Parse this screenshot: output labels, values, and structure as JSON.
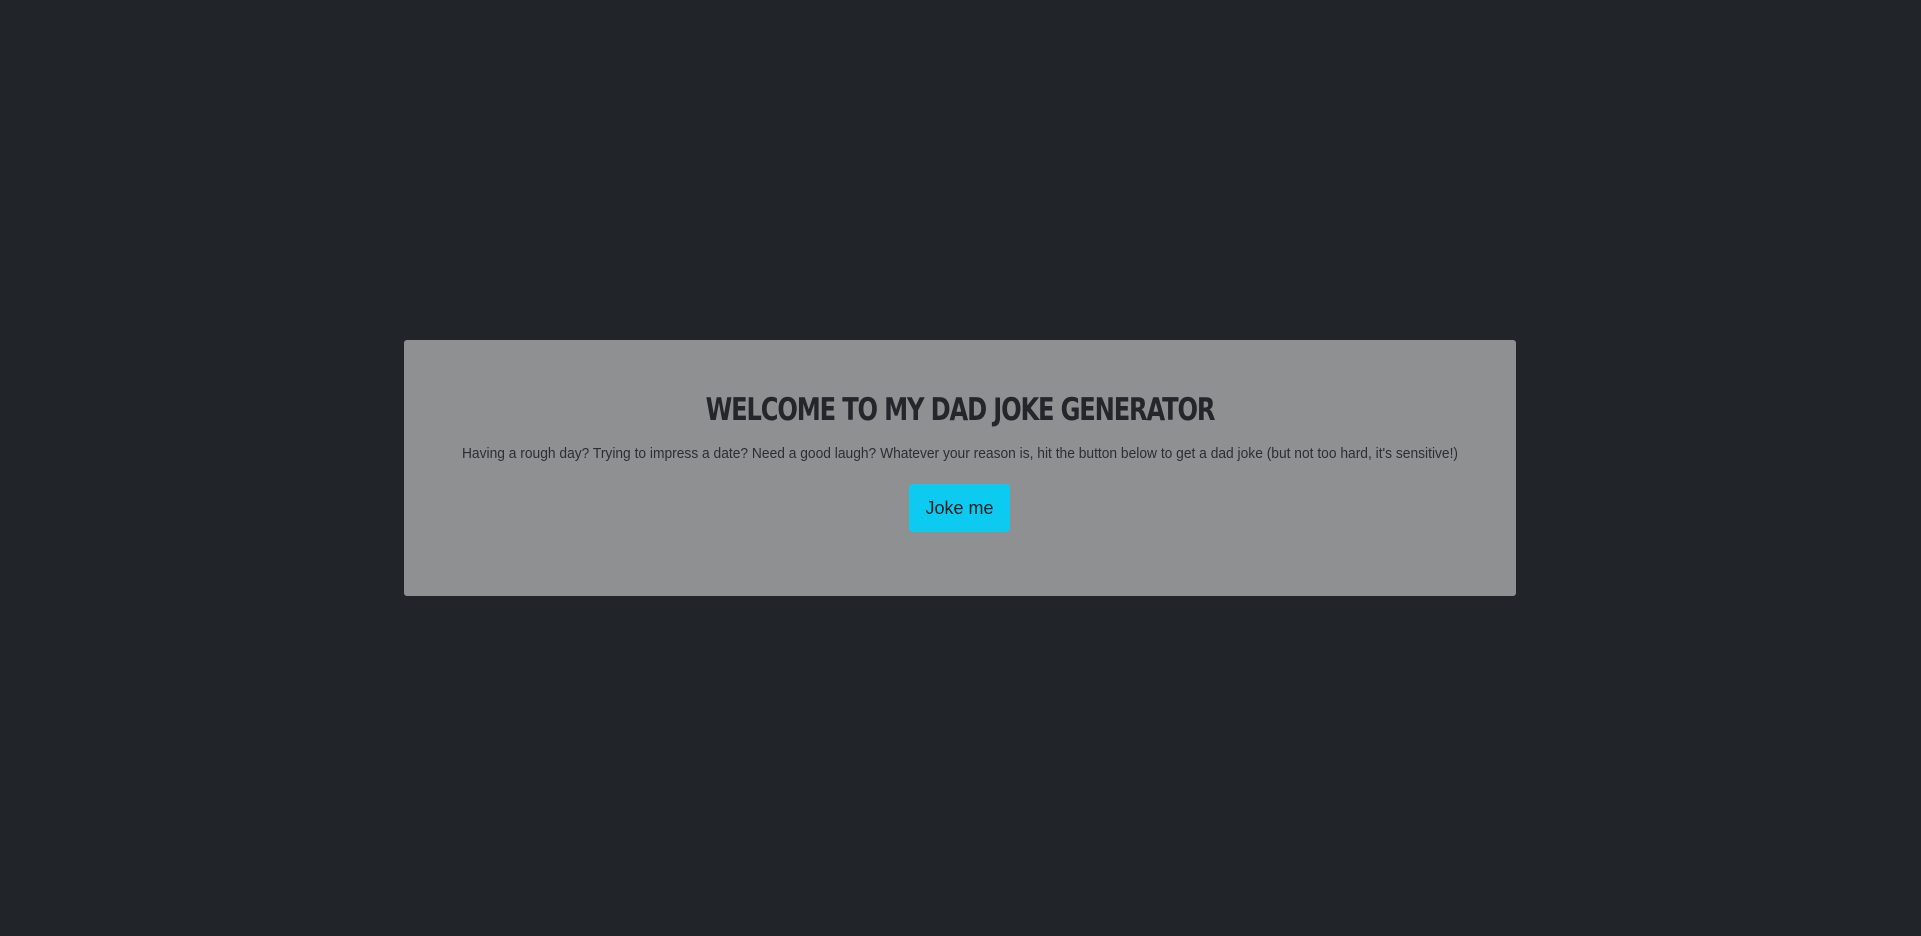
{
  "page": {
    "background_color": "#212429"
  },
  "card": {
    "background_color": "#8f9092",
    "title": "Welcome to my Dad Joke Generator",
    "subtitle": "Having a rough day? Trying to impress a date? Need a good laugh? Whatever your reason is, hit the button below to get a dad joke (but not too hard, it's sensitive!)",
    "button_label": "Joke me",
    "button_color": "#0dcaf0",
    "joke_text": ""
  }
}
